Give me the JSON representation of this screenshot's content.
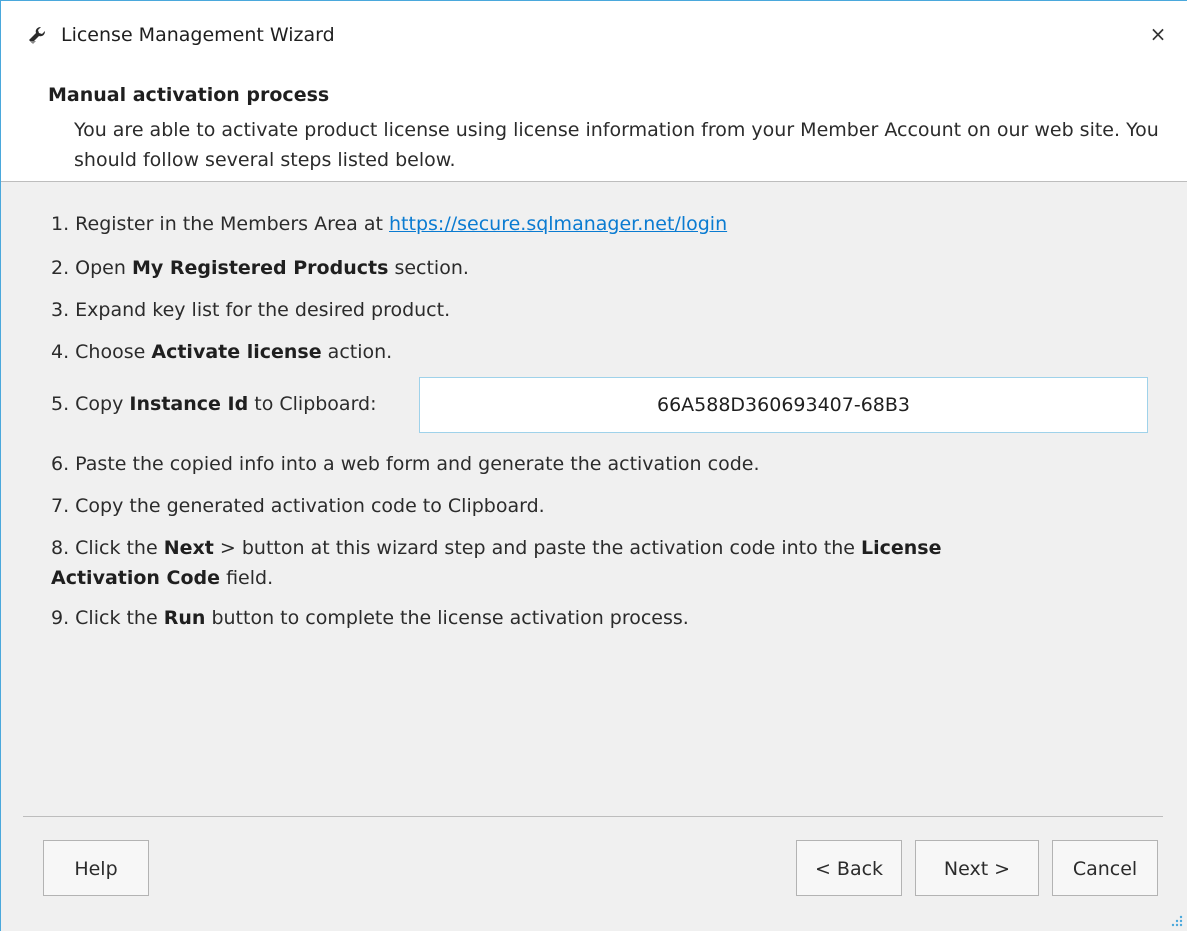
{
  "window": {
    "title": "License Management Wizard",
    "close_glyph": "×",
    "icon": "wrench-icon",
    "accent_color": "#4aa8dc"
  },
  "header": {
    "title": "Manual activation process",
    "description": "You are able to activate product license using license information from your Member Account on our web site. You should follow several steps listed below."
  },
  "steps": {
    "s1": {
      "prefix": "1. Register in the Members Area at",
      "link": "https://secure.sqlmanager.net/login"
    },
    "s2": {
      "prefix": "2. Open",
      "bold": "My Registered Products",
      "suffix": "section."
    },
    "s3": {
      "text": "3. Expand key list for the desired product."
    },
    "s4": {
      "prefix": "4. Choose",
      "bold": "Activate license",
      "suffix": "action."
    },
    "s5": {
      "prefix": "5. Copy",
      "bold": "Instance Id",
      "suffix": "to Clipboard:",
      "instance_id": "66A588D360693407-68B3"
    },
    "s6": {
      "text": "6. Paste the copied info into a web form and generate the activation code."
    },
    "s7": {
      "text": "7. Copy the generated activation code to Clipboard."
    },
    "s8": {
      "prefix": "8. Click the",
      "bold1": "Next",
      "mid": "> button at this wizard step and paste the activation code into the",
      "bold2": "License Activation Code",
      "suffix": "field."
    },
    "s9": {
      "prefix": "9. Click the",
      "bold": "Run",
      "suffix": "button to complete the license activation process."
    }
  },
  "buttons": {
    "help": "Help",
    "back": "< Back",
    "next": "Next >",
    "cancel": "Cancel"
  }
}
